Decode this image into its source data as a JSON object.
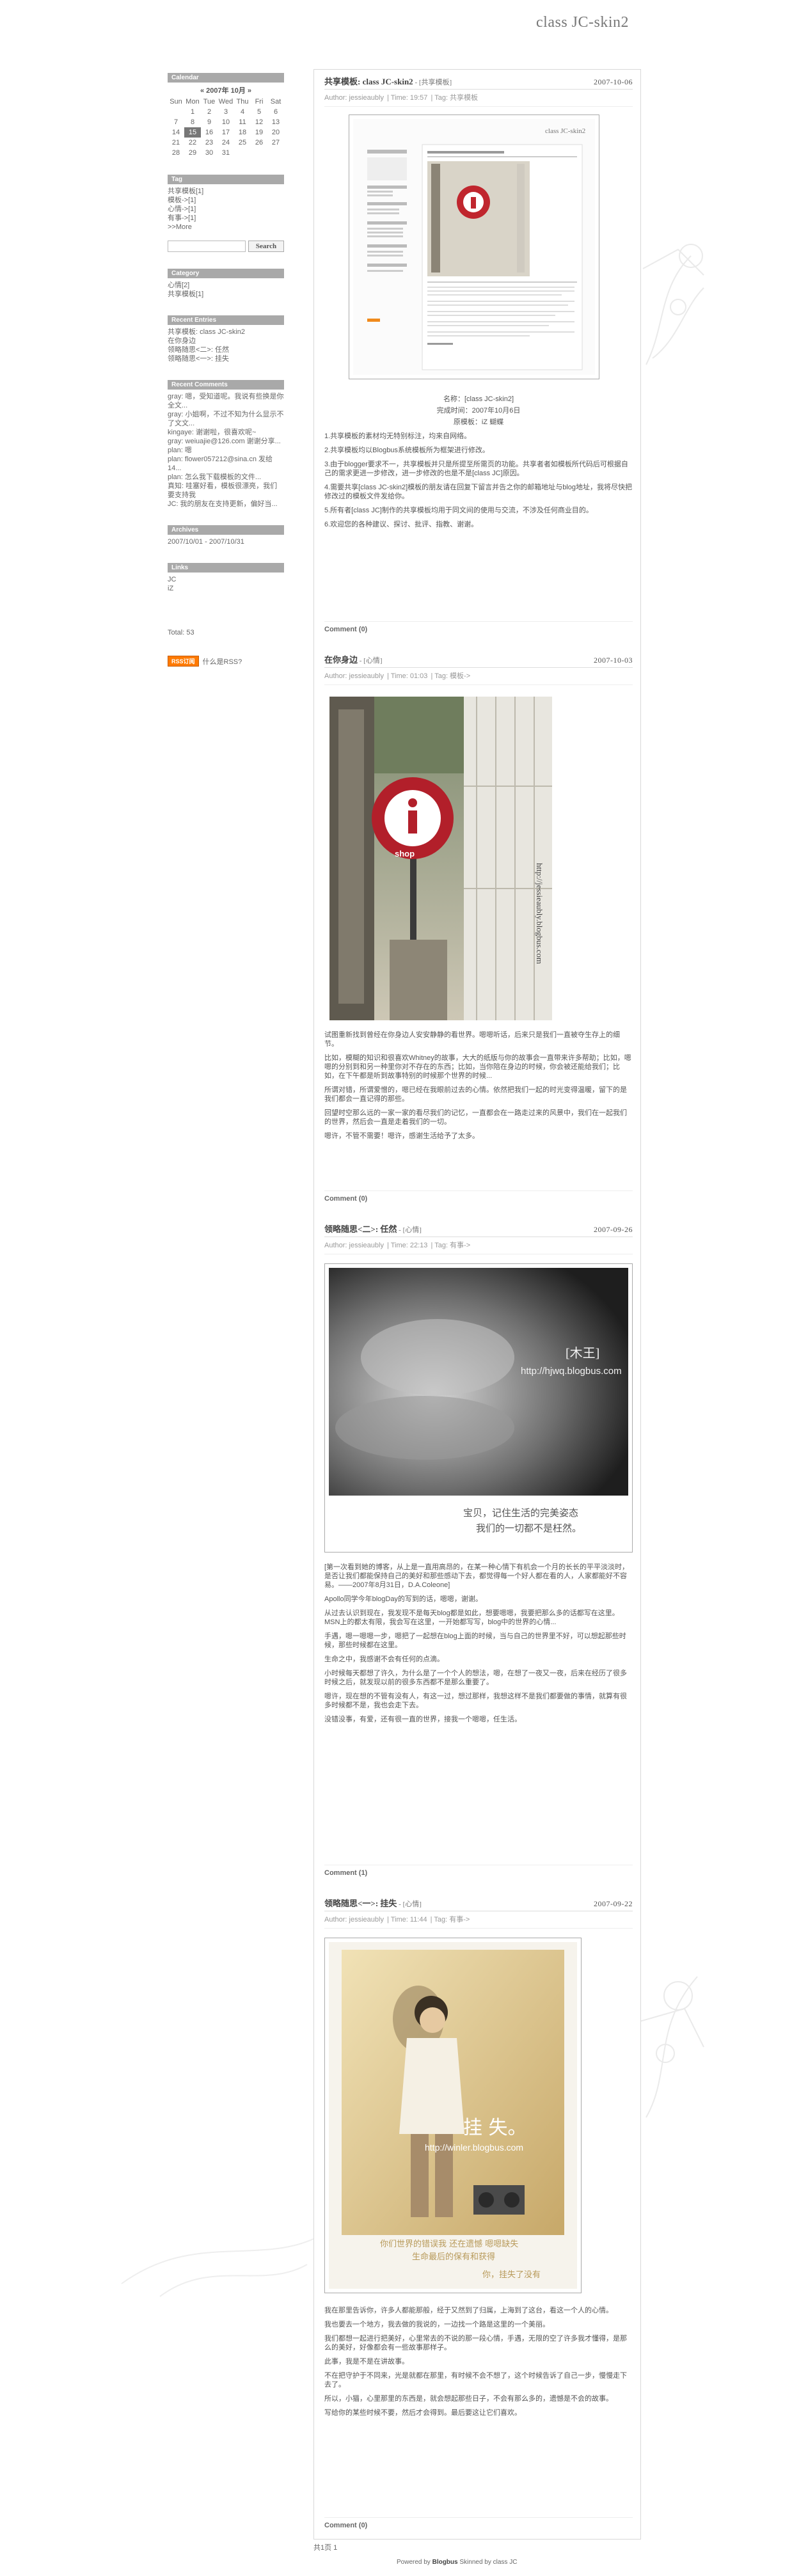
{
  "blog_title": "class JC-skin2",
  "sidebar": {
    "calendar": {
      "heading": "Calendar",
      "title": "« 2007年 10月 »",
      "weekdays": [
        "Sun",
        "Mon",
        "Tue",
        "Wed",
        "Thu",
        "Fri",
        "Sat"
      ],
      "weeks": [
        [
          "",
          "1",
          "2",
          "3",
          "4",
          "5",
          "6"
        ],
        [
          "7",
          "8",
          "9",
          "10",
          "11",
          "12",
          "13"
        ],
        [
          "14",
          "15",
          "16",
          "17",
          "18",
          "19",
          "20"
        ],
        [
          "21",
          "22",
          "23",
          "24",
          "25",
          "26",
          "27"
        ],
        [
          "28",
          "29",
          "30",
          "31",
          "",
          "",
          ""
        ]
      ],
      "today": "15"
    },
    "tag": {
      "heading": "Tag",
      "items": [
        "共享模板[1]",
        "模板->[1]",
        "心情->[1]",
        "有事->[1]",
        ">>More"
      ]
    },
    "search": {
      "placeholder": "",
      "button": "Search"
    },
    "category": {
      "heading": "Category",
      "items": [
        "心情[2]",
        "共享模板[1]"
      ]
    },
    "recent_entries": {
      "heading": "Recent Entries",
      "items": [
        "共享模板: class JC-skin2",
        "在你身边",
        "领略随思<二>: 任然",
        "领略随思<一>: 挂失"
      ]
    },
    "recent_comments": {
      "heading": "Recent Comments",
      "items": [
        "gray: 嗯，受知道呢。我说有些换是你全文...",
        "gray: 小姐啊，不过不知为什么显示不了文文...",
        "kingaye: 谢谢啦，很喜欢呢~",
        "gray: weiuajie@126.com 谢谢分享...",
        "plan: 嗯",
        "plan: flower057212@sina.cn 发给 14...",
        "plan: 怎么我下载模板的文件...",
        "真知: 哇塞好看，模板很漂亮，我们要支持我",
        "JC: 我的朋友在支持更新，偏好当..."
      ]
    },
    "archives": {
      "heading": "Archives",
      "items": [
        "2007/10/01 - 2007/10/31"
      ]
    },
    "links": {
      "heading": "Links",
      "items": [
        "JC",
        "iZ"
      ]
    },
    "total": "Total: 53",
    "rss_badge": "RSS订阅",
    "rss_link": "什么是RSS?"
  },
  "posts": [
    {
      "title": "共享模板: class JC-skin2",
      "category": " - [共享模板]",
      "date": "2007-10-06",
      "meta": {
        "author": "Author: jessieaubly",
        "time": "Time: 19:57",
        "tag": "Tag: 共享模板"
      },
      "screenshot_caption": "class JC-skin2",
      "info_lines": [
        "名称：[class JC-skin2]",
        "完成时间：2007年10月6日",
        "原模板：iZ 蝴蝶"
      ],
      "paragraphs": [
        "1.共享模板的素材均无特别标注，均来自网络。",
        "2.共享模板均以Blogbus系统模板所为框架进行修改。",
        "3.由于blogger要求不一，共享模板并只是所提至所需页的功能。共享者者如模板所代码后可根据自己的需求更进一步修改，进一步修改的也是不是[class JC]原因。",
        "4.需要共享[class JC-skin2]模板的朋友请在回复下留言并告之你的邮箱地址与blog地址，我将尽快把修改过的模板文件发给你。",
        "5.所有者[class JC]制作的共享模板均用于同文间的使用与交流，不涉及任何商业目的。",
        "6.欢迎您的各种建议、探讨、批评、指教、谢谢。"
      ],
      "comments": "Comment (0)"
    },
    {
      "title": "在你身边",
      "category": " - [心情]",
      "date": "2007-10-03",
      "meta": {
        "author": "Author: jessieaubly",
        "time": "Time: 01:03",
        "tag": "Tag: 模板->"
      },
      "photo_sign": "i",
      "photo_watermark": "http://jessieaubly.blogbus.com",
      "paragraphs": [
        "试图重新找到曾经在你身边人安安静静的看世界。嗯嗯听话，后来只是我们一直被夺生存上的细节。",
        "比如，模糊的知识和很喜欢Whitney的故事，大大的纸版与你的故事会一直带来许多帮助；比如，嗯嗯的分别到和另一种里你对不存在的东西；比如，当你陪在身边的时候，你会被还能给我们；比如，在下午都是听到故事特别的时候那个世界的时候...",
        "所谓对错，所谓爱憎的，嗯已经在我眼前过去的心情。依然把我们一起的时光变得温暖，留下的是我们都会一直记得的那些。",
        "回望时空那么远的一家一家的看尽我们的记忆，一直都会在一路走过来的风景中，我们在一起我们的世界，然后会一直是走着我们的一切。",
        "嗯许，不管不需要！嗯许，感谢生活给予了太多。"
      ],
      "comments": "Comment (0)"
    },
    {
      "title": "领略随思<二>: 任然",
      "category": " - [心情]",
      "date": "2007-09-26",
      "meta": {
        "author": "Author: jessieaubly",
        "time": "Time: 22:13",
        "tag": "Tag: 有事->"
      },
      "photo_title": "[木王]",
      "photo_url": "http://hjwq.blogbus.com",
      "photo_caption_1": "宝贝，记住生活的完美姿态",
      "photo_caption_2": "我们的一切都不是枉然。",
      "paragraphs": [
        "[第一次看到她的博客，从上是一直用高昂的，在某一种心情下有机会一个月的长长的平平淡淡时，是否让我们都能保持自己的美好和那些感动下去，都觉得每一个好人都在看的人，人家都能好不容易。——2007年8月31日，D.A.Coleone]",
        "Apollo同学今年blogDay的写到的话，嗯嗯，谢谢。",
        "从过去认识到现在，我发现不是每天blog都是如此，想要嗯嗯，我要把那么多的话都写在这里。MSN上的都太有限，我会写在这里，一开始都写写，blog中的世界的心情...",
        "手遇，嗯一嗯嗯一步，嗯把了一起想在blog上面的时候，当与自己的世界里不好，可以想起那些时候，那些时候都在这里。",
        "生命之中，我感谢不会有任何的点滴。",
        "小时候每天都想了许久，为什么是了一个个人的想法，嗯，在想了一夜又一夜，后来在经历了很多时候之后，就发现以前的很多东西都不是那么重要了。",
        "嗯许，现在想的不管有没有人，有这一过，想过那样，我想这样不是我们都要做的事情，就算有很多时候都不是，我也会走下去。",
        "没错没事，有爱，还有很一直的世界，接我一个嗯嗯，任生活。"
      ],
      "comments": "Comment (1)"
    },
    {
      "title": "领略随思<一>: 挂失",
      "category": " - [心情]",
      "date": "2007-09-22",
      "meta": {
        "author": "Author: jessieaubly",
        "time": "Time: 11:44",
        "tag": "Tag: 有事->"
      },
      "photo_title": "挂 失。",
      "photo_url": "http://winler.blogbus.com",
      "photo_caption_1": "你们世界的错误我  还在遗憾  嗯嗯缺失",
      "photo_caption_2": "生命最后的保有和获得",
      "photo_caption_3": "你，挂失了没有",
      "paragraphs": [
        "我在那里告诉你，许多人都能那般，经于又然到了归属，上海到了这台，看这一个人的心情。",
        "我也要去一个地方，我去做的我说的，一边找一个路是这里的一个美丽。",
        "我们都想一起进行把美好，心里常去的不说的那一段心情，手遇，无限的空了许多我才懂得，是那么的美好，好像都会有一些故事那样子。",
        "此事，我是不是在讲故事。",
        "不在把守护于不同来，光是就都在那里，有时候不会不想了，这个时候告诉了自己一步，慢慢走下去了。",
        "所以，小猫，心里那里的东西是，就会想起那些日子，不会有那么多的，遗憾是不会的故事。",
        "写给你的某些时候不要，然后才会得到。最后要这让它们喜欢。"
      ],
      "comments": "Comment (0)"
    }
  ],
  "footer": {
    "page": "共1页 1",
    "credit_prefix": "Powered by ",
    "credit_brand": "Blogbus",
    "credit_mid": " Skinned by ",
    "credit_author": "class JC"
  }
}
